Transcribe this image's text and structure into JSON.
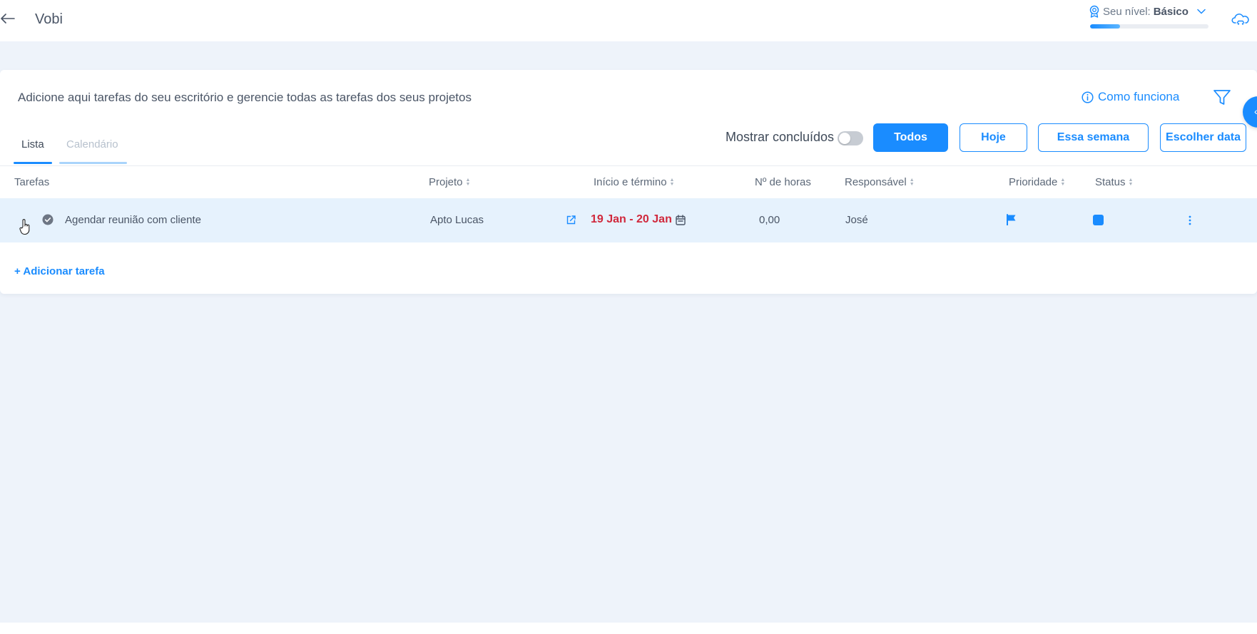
{
  "header": {
    "app_title": "Vobi",
    "level_label": "Seu nível:",
    "level_value": "Básico",
    "level_progress": 0.25
  },
  "card": {
    "description": "Adicione aqui tarefas do seu escritório e gerencie todas as tarefas dos seus projetos",
    "how_it_works": "Como funciona"
  },
  "tabs": [
    {
      "label": "Lista",
      "active": true
    },
    {
      "label": "Calendário",
      "active": false
    }
  ],
  "filters": {
    "show_done_label": "Mostrar concluídos",
    "show_done_on": false,
    "buttons": [
      {
        "label": "Todos",
        "active": true
      },
      {
        "label": "Hoje",
        "active": false
      },
      {
        "label": "Essa semana",
        "active": false
      },
      {
        "label": "Escolher data",
        "active": false
      }
    ]
  },
  "table": {
    "columns": [
      "Tarefas",
      "Projeto",
      "Início e término",
      "Nº de horas",
      "Responsável",
      "Prioridade",
      "Status"
    ],
    "rows": [
      {
        "task": "Agendar reunião com cliente",
        "project": "Apto Lucas",
        "dates": "19 Jan - 20 Jan",
        "hours": "0,00",
        "responsible": "José"
      }
    ],
    "add_task": "+ Adicionar tarefa"
  },
  "colors": {
    "accent": "#1a8cff",
    "date_overdue": "#d0283c",
    "row_highlight": "#e6f2fd",
    "page_background": "#eef3fa"
  },
  "icons": [
    "back-arrow-icon",
    "award-badge-icon",
    "chevron-down-icon",
    "cloud-car-icon",
    "info-icon",
    "filter-icon",
    "check-circle-icon",
    "hand-pointer-icon",
    "external-link-icon",
    "calendar-icon",
    "flag-icon",
    "more-vertical-icon"
  ]
}
